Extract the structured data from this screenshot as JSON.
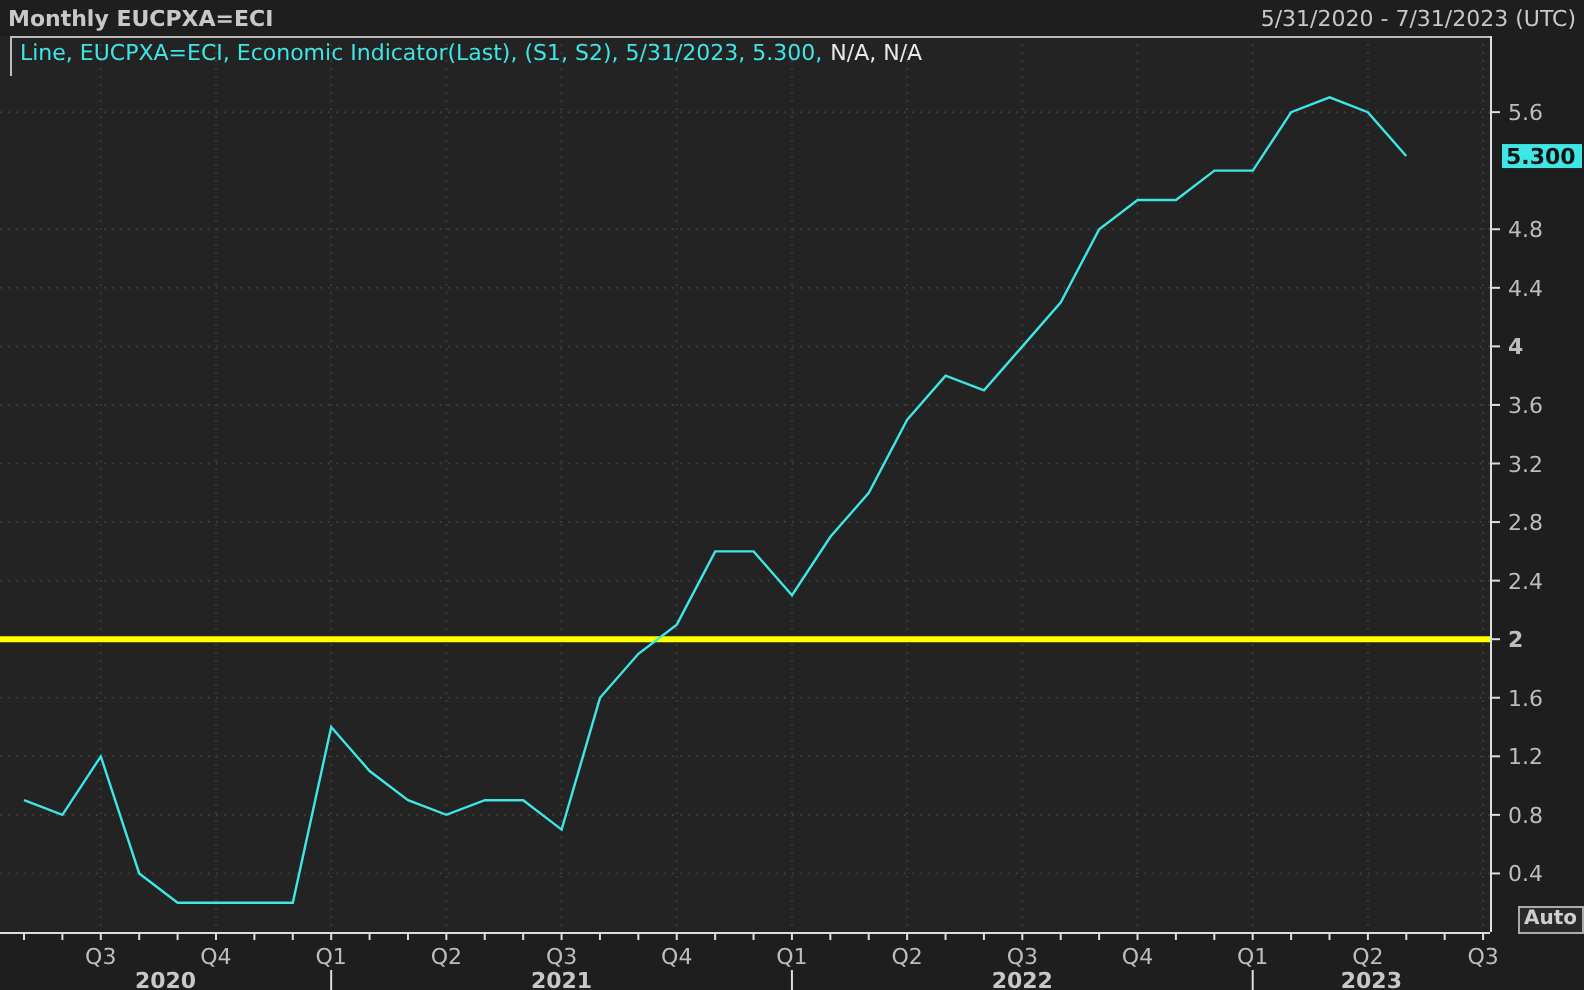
{
  "header": {
    "title": "Monthly EUCPXA=ECI",
    "date_range": "5/31/2020 - 7/31/2023 (UTC)"
  },
  "legend": {
    "series": "Line, EUCPXA=ECI, Economic Indicator(Last), (S1, S2), 5/31/2023, 5.300,",
    "status": "N/A, N/A"
  },
  "chart": {
    "chart_data": {
      "type": "line",
      "categories": [
        null,
        null,
        "Q3",
        null,
        null,
        "Q4",
        null,
        null,
        "Q1",
        null,
        null,
        "Q2",
        null,
        null,
        "Q3",
        null,
        null,
        "Q4",
        null,
        null,
        "Q1",
        null,
        null,
        "Q2",
        null,
        null,
        "Q3",
        null,
        null,
        "Q4",
        null,
        null,
        "Q1",
        null,
        null,
        "Q2",
        null,
        null,
        "Q3"
      ],
      "series": [
        {
          "color": "#3fe6e6",
          "values": [
            0.9,
            0.8,
            1.2,
            0.4,
            0.2,
            0.2,
            0.2,
            0.2,
            1.4,
            1.1,
            0.9,
            0.8,
            0.9,
            0.9,
            0.7,
            1.6,
            1.9,
            2.1,
            2.6,
            2.6,
            2.3,
            2.7,
            3.0,
            3.5,
            3.8,
            3.7,
            4.0,
            4.3,
            4.8,
            5.0,
            5.0,
            5.2,
            5.2,
            5.6,
            5.7,
            5.6,
            5.3,
            null,
            null
          ]
        }
      ],
      "ylim": [
        0,
        6.12
      ],
      "yticks": [
        {
          "value": 0.4,
          "label": "0.4"
        },
        {
          "value": 0.8,
          "label": "0.8"
        },
        {
          "value": 1.2,
          "label": "1.2"
        },
        {
          "value": 1.6,
          "label": "1.6"
        },
        {
          "value": 2,
          "label": "2"
        },
        {
          "value": 2.4,
          "label": "2.4"
        },
        {
          "value": 2.8,
          "label": "2.8"
        },
        {
          "value": 3.2,
          "label": "3.2"
        },
        {
          "value": 3.6,
          "label": "3.6"
        },
        {
          "value": 4,
          "label": "4"
        },
        {
          "value": 4.4,
          "label": "4.4"
        },
        {
          "value": 4.8,
          "label": "4.8"
        },
        {
          "value": 5.6,
          "label": "5.6"
        }
      ],
      "grid": true,
      "ref_lines": [
        {
          "axis": "y",
          "value": 2,
          "color": "#ffff00"
        }
      ]
    },
    "last_value": "5.300",
    "years": [
      "2020",
      "2021",
      "2022",
      "2023"
    ]
  },
  "auto_button": "Auto"
}
